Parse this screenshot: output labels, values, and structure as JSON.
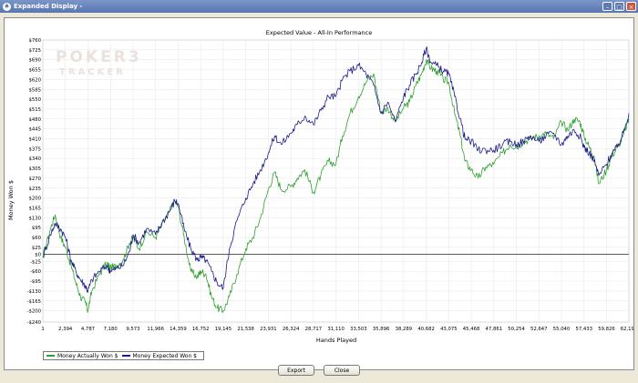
{
  "window": {
    "title": "Expanded Display -"
  },
  "watermark": {
    "line1": "POKER3",
    "line2": "TRACKER"
  },
  "chart_data": {
    "type": "line",
    "title": "Expected Value - All-In Performance",
    "xlabel": "Hands Played",
    "ylabel": "Money Won $",
    "xlim": [
      1,
      62193
    ],
    "ylim": [
      -240,
      760
    ],
    "grid": true,
    "zero_line": true,
    "x_ticks": [
      1,
      2394,
      4787,
      7180,
      9573,
      11966,
      14359,
      16752,
      19145,
      21538,
      23931,
      26324,
      28717,
      31110,
      33503,
      35896,
      38289,
      40682,
      43075,
      45468,
      47861,
      50254,
      52647,
      55040,
      57433,
      59826,
      62193
    ],
    "x_tick_labels": [
      "1",
      "2,394",
      "4,787",
      "7,180",
      "9,573",
      "11,966",
      "14,359",
      "16,752",
      "19,145",
      "21,538",
      "23,931",
      "26,324",
      "28,717",
      "31,110",
      "33,503",
      "35,896",
      "38,289",
      "40,682",
      "43,075",
      "45,468",
      "47,861",
      "50,254",
      "52,647",
      "55,040",
      "57,433",
      "59,826",
      "62,193"
    ],
    "y_ticks": [
      760,
      725,
      690,
      655,
      620,
      585,
      550,
      515,
      480,
      445,
      410,
      375,
      340,
      305,
      270,
      235,
      200,
      165,
      130,
      95,
      60,
      25,
      0,
      -25,
      -60,
      -95,
      -130,
      -165,
      -200,
      -240
    ],
    "y_tick_labels": [
      "$760",
      "$725",
      "$690",
      "$655",
      "$620",
      "$585",
      "$550",
      "$515",
      "$480",
      "$445",
      "$410",
      "$375",
      "$340",
      "$305",
      "$270",
      "$235",
      "$200",
      "$165",
      "$130",
      "$95",
      "$60",
      "$25",
      "$0",
      "-$25",
      "-$60",
      "-$95",
      "-$130",
      "-$165",
      "-$200",
      "-$240"
    ],
    "legend_position": "bottom-left",
    "series": [
      {
        "name": "Money Actually Won $",
        "color": "#2ca02c",
        "x": [
          1,
          800,
          1300,
          1900,
          2400,
          3000,
          3500,
          4000,
          4500,
          4787,
          5200,
          6000,
          6800,
          7180,
          7800,
          8500,
          9200,
          9573,
          10200,
          11000,
          11966,
          12600,
          13400,
          14000,
          14359,
          15000,
          15700,
          16400,
          16752,
          17300,
          17900,
          18500,
          19145,
          19800,
          20600,
          21538,
          22300,
          23100,
          23931,
          24600,
          25300,
          26324,
          27000,
          27800,
          28717,
          29500,
          30300,
          31110,
          31800,
          32600,
          33503,
          34300,
          35100,
          35896,
          36600,
          37400,
          38289,
          38900,
          39600,
          40200,
          40682,
          41200,
          41800,
          42500,
          43075,
          43700,
          44300,
          44800,
          45468,
          46200,
          47000,
          47861,
          48800,
          49600,
          50254,
          51000,
          51800,
          52647,
          53400,
          54200,
          55040,
          55700,
          56400,
          57000,
          57433,
          58000,
          58500,
          59000,
          59826,
          60400,
          61000,
          61600,
          62193
        ],
        "values": [
          -10,
          90,
          140,
          60,
          25,
          -40,
          -100,
          -150,
          -170,
          -200,
          -130,
          -70,
          -30,
          -50,
          -40,
          -20,
          40,
          60,
          20,
          80,
          60,
          100,
          150,
          190,
          170,
          60,
          -60,
          -80,
          -60,
          -70,
          -150,
          -190,
          -200,
          -150,
          -70,
          20,
          60,
          130,
          230,
          290,
          230,
          240,
          270,
          300,
          220,
          280,
          330,
          320,
          420,
          500,
          560,
          610,
          640,
          500,
          520,
          470,
          520,
          540,
          600,
          640,
          690,
          660,
          650,
          620,
          610,
          500,
          420,
          330,
          300,
          270,
          310,
          320,
          360,
          390,
          380,
          400,
          410,
          420,
          430,
          410,
          470,
          440,
          480,
          470,
          420,
          380,
          350,
          250,
          300,
          350,
          380,
          420,
          480
        ]
      },
      {
        "name": "Money Expected Won $",
        "color": "#1a1a8c",
        "x": [
          1,
          800,
          1300,
          1900,
          2400,
          3000,
          3500,
          4000,
          4500,
          4787,
          5200,
          6000,
          6800,
          7180,
          7800,
          8500,
          9200,
          9573,
          10200,
          11000,
          11966,
          12600,
          13400,
          14000,
          14359,
          15000,
          15700,
          16400,
          16752,
          17300,
          17900,
          18500,
          19145,
          19800,
          20600,
          21538,
          22300,
          23100,
          23931,
          24600,
          25300,
          26324,
          27000,
          27800,
          28717,
          29500,
          30300,
          31110,
          31800,
          32600,
          33503,
          34300,
          35100,
          35896,
          36600,
          37400,
          38289,
          38900,
          39600,
          40200,
          40682,
          41200,
          41800,
          42500,
          43075,
          43700,
          44300,
          44800,
          45468,
          46200,
          47000,
          47861,
          48800,
          49600,
          50254,
          51000,
          51800,
          52647,
          53400,
          54200,
          55040,
          55700,
          56400,
          57000,
          57433,
          58000,
          58500,
          59000,
          59826,
          60400,
          61000,
          61600,
          62193
        ],
        "values": [
          -10,
          70,
          110,
          90,
          60,
          -20,
          -60,
          -90,
          -110,
          -130,
          -90,
          -60,
          -40,
          -60,
          -50,
          -40,
          10,
          70,
          40,
          90,
          70,
          110,
          150,
          190,
          180,
          90,
          20,
          -20,
          -10,
          -20,
          -60,
          -100,
          -120,
          20,
          120,
          200,
          250,
          300,
          360,
          420,
          390,
          430,
          460,
          490,
          460,
          510,
          560,
          560,
          620,
          650,
          670,
          640,
          600,
          500,
          540,
          470,
          560,
          600,
          640,
          680,
          730,
          680,
          670,
          650,
          640,
          560,
          480,
          410,
          400,
          370,
          370,
          370,
          390,
          400,
          390,
          400,
          420,
          400,
          420,
          430,
          390,
          420,
          440,
          420,
          380,
          360,
          330,
          280,
          320,
          360,
          380,
          430,
          500
        ]
      }
    ]
  },
  "buttons": {
    "export": "Export",
    "close": "Close"
  }
}
